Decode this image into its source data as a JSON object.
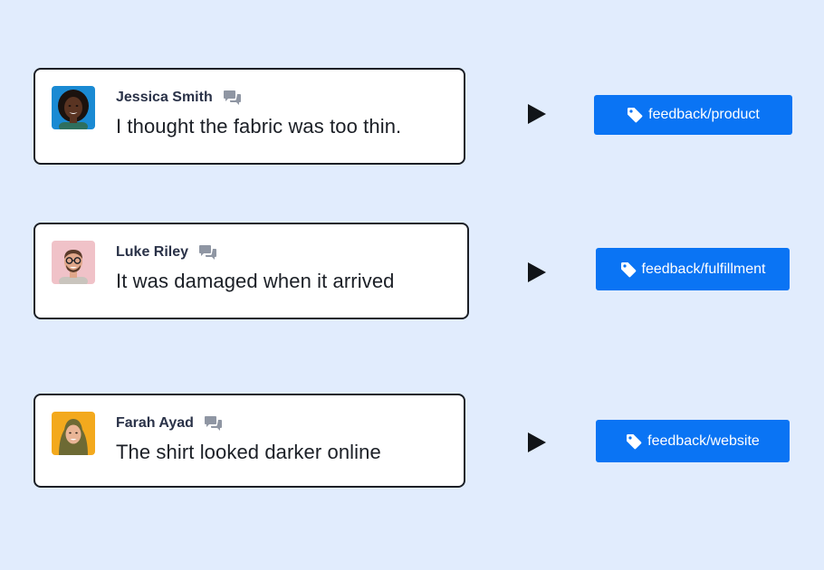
{
  "feedback_items": [
    {
      "author": "Jessica Smith",
      "message": "I thought the fabric was too thin.",
      "tag": "feedback/product",
      "avatar": {
        "background": "#1a8ad3",
        "skin": "#5a3422",
        "hair": "#1b120e",
        "shirt": "#2e6f5e"
      }
    },
    {
      "author": "Luke Riley",
      "message": "It was damaged when it arrived",
      "tag": "feedback/fulfillment",
      "avatar": {
        "background": "#f0c2c8",
        "skin": "#e0a78a",
        "hair": "#5a3b2a",
        "shirt": "#c9c4bd"
      }
    },
    {
      "author": "Farah Ayad",
      "message": "The shirt looked darker online",
      "tag": "feedback/website",
      "avatar": {
        "background": "#f3a91d",
        "skin": "#e9b596",
        "hair": "#6d6a34",
        "shirt": "#6d6a34"
      }
    }
  ],
  "icons": {
    "comment": "chat-bubbles-icon",
    "arrow": "play-arrow-icon",
    "tag": "tag-icon"
  },
  "colors": {
    "background": "#e1ecfd",
    "card_border": "#1b1f26",
    "tag_button": "#0a74f4",
    "icon_gray": "#8f96a3"
  }
}
